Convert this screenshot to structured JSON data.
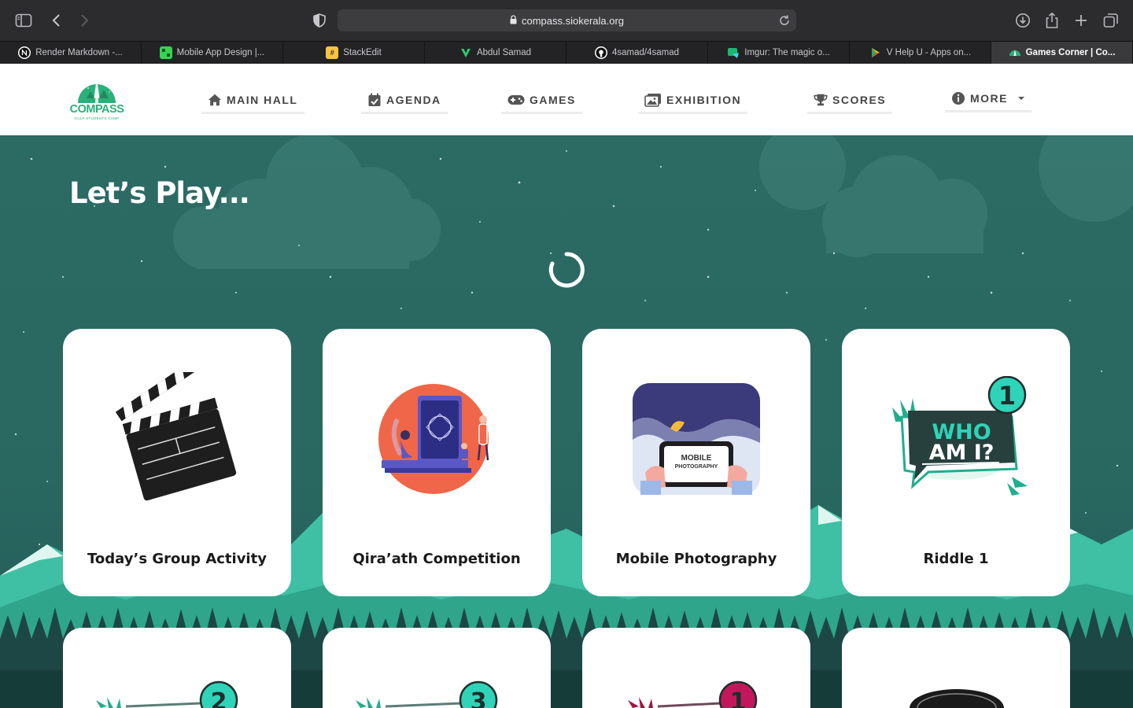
{
  "browser": {
    "url": "compass.siokerala.org",
    "tabs": [
      {
        "label": "Render Markdown -...",
        "icon": "notion-icon",
        "color": "#ffffff"
      },
      {
        "label": "Mobile App Design |...",
        "icon": "grid-icon",
        "color": "#39d353"
      },
      {
        "label": "StackEdit",
        "icon": "stackedit-icon",
        "color": "#f6c343"
      },
      {
        "label": "Abdul Samad",
        "icon": "v-logo-icon",
        "color": "#2ecc71"
      },
      {
        "label": "4samad/4samad",
        "icon": "github-icon",
        "color": "#ffffff"
      },
      {
        "label": "Imgur: The magic o...",
        "icon": "imgur-icon",
        "color": "#1bb76e"
      },
      {
        "label": "V Help U - Apps on...",
        "icon": "play-store-icon",
        "color": "#00c3ff"
      },
      {
        "label": "Games Corner | Co...",
        "icon": "compass-icon",
        "color": "#2ab07a",
        "active": true
      }
    ]
  },
  "site": {
    "logo_text": "COMPASS",
    "logo_subtext": "GULF STUDENTS CAMP",
    "nav": [
      {
        "label": "MAIN HALL",
        "icon": "home-icon"
      },
      {
        "label": "AGENDA",
        "icon": "calendar-check-icon"
      },
      {
        "label": "GAMES",
        "icon": "gamepad-icon"
      },
      {
        "label": "EXHIBITION",
        "icon": "images-icon"
      },
      {
        "label": "SCORES",
        "icon": "trophy-icon"
      },
      {
        "label": "MORE",
        "icon": "info-circle-icon",
        "dropdown": true
      }
    ]
  },
  "hero": {
    "title": "Let’s Play..."
  },
  "cards": [
    {
      "title": "Today’s Group Activity",
      "icon": "clapperboard-icon"
    },
    {
      "title": "Qira’ath Competition",
      "icon": "quran-reading-icon"
    },
    {
      "title": "Mobile Photography",
      "icon": "mobile-photography-icon"
    },
    {
      "title": "Riddle 1",
      "icon": "who-am-i-icon",
      "badge": "1"
    }
  ],
  "cards_row2": [
    {
      "badge": "2",
      "icon": "who-am-i-icon"
    },
    {
      "badge": "3",
      "icon": "who-am-i-icon"
    },
    {
      "badge": "1",
      "icon": "who-am-i-red-icon"
    },
    {
      "icon": "dark-circle-icon"
    }
  ],
  "colors": {
    "brand": "#2ab07a",
    "hero_bg": "#2a6760",
    "mountain": "#3fbfa3",
    "forest": "#1f4a47",
    "badge": "#2fd3b8"
  }
}
